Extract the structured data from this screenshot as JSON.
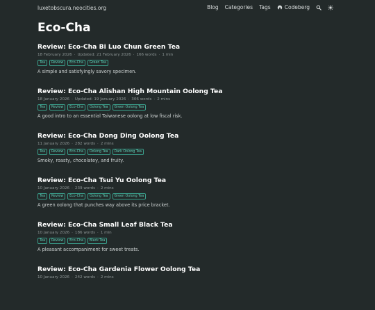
{
  "site": {
    "title": "luxetobscura.neocities.org"
  },
  "nav": {
    "blog": "Blog",
    "categories": "Categories",
    "tags": "Tags",
    "codeberg": "Codeberg"
  },
  "page": {
    "title": "Eco-Cha"
  },
  "posts": [
    {
      "title": "Review: Eco-Cha Bi Luo Chun Green Tea",
      "date": "18 February 2026",
      "updated": "Updated: 21 February 2026",
      "words": "166 words",
      "read": "1 min",
      "tags": [
        "Tea",
        "Review",
        "Eco-Cha",
        "Green Tea"
      ],
      "summary": "A simple and satisfyingly savory specimen."
    },
    {
      "title": "Review: Eco-Cha Alishan High Mountain Oolong Tea",
      "date": "18 January 2026",
      "updated": "Updated: 19 January 2026",
      "words": "306 words",
      "read": "2 mins",
      "tags": [
        "Tea",
        "Review",
        "Eco-Cha",
        "Oolong Tea",
        "Green Oolong Tea"
      ],
      "summary": "A good intro to an essential Taiwanese oolong at low fiscal risk."
    },
    {
      "title": "Review: Eco-Cha Dong Ding Oolong Tea",
      "date": "11 January 2026",
      "updated": "",
      "words": "282 words",
      "read": "2 mins",
      "tags": [
        "Tea",
        "Review",
        "Eco-Cha",
        "Oolong Tea",
        "Dark Oolong Tea"
      ],
      "summary": "Smoky, roasty, chocolatey, and fruity."
    },
    {
      "title": "Review: Eco-Cha Tsui Yu Oolong Tea",
      "date": "10 January 2026",
      "updated": "",
      "words": "239 words",
      "read": "2 mins",
      "tags": [
        "Tea",
        "Review",
        "Eco-Cha",
        "Oolong Tea",
        "Green Oolong Tea"
      ],
      "summary": "A green oolong that punches way above its price bracket."
    },
    {
      "title": "Review: Eco-Cha Small Leaf Black Tea",
      "date": "10 January 2026",
      "updated": "",
      "words": "186 words",
      "read": "1 min",
      "tags": [
        "Tea",
        "Review",
        "Eco-Cha",
        "Black Tea"
      ],
      "summary": "A pleasant accompaniment for sweet treats."
    },
    {
      "title": "Review: Eco-Cha Gardenia Flower Oolong Tea",
      "date": "10 January 2026",
      "updated": "",
      "words": "242 words",
      "read": "2 mins",
      "tags": [],
      "summary": ""
    }
  ],
  "icons": {
    "codeberg": "codeberg-icon",
    "search": "search-icon",
    "theme": "theme-toggle-icon"
  },
  "colors": {
    "background": "#232a2a",
    "tag": "#5fd0b8",
    "meta": "#8f9797"
  }
}
